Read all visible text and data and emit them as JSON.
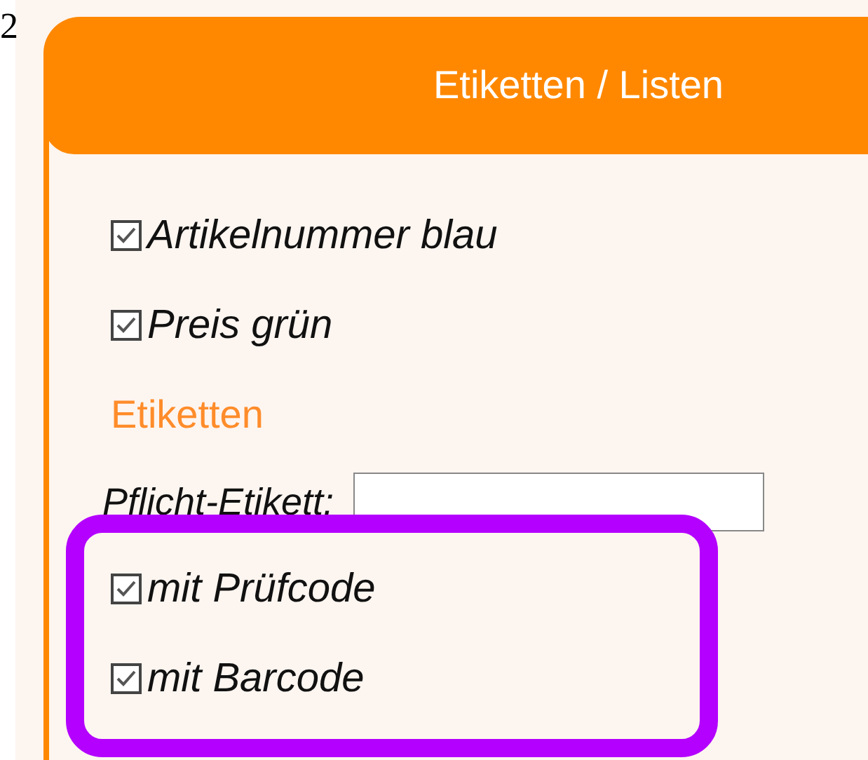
{
  "page_marker": "2",
  "panel": {
    "title": "Etiketten / Listen",
    "options": [
      {
        "label": "Artikelnummer blau",
        "checked": true
      },
      {
        "label": "Preis grün",
        "checked": true
      }
    ],
    "section_heading": "Etiketten",
    "field": {
      "label": "Pflicht-Etikett:"
    },
    "label_options": [
      {
        "label": "mit Prüfcode",
        "checked": true
      },
      {
        "label": "mit Barcode",
        "checked": true
      }
    ]
  }
}
